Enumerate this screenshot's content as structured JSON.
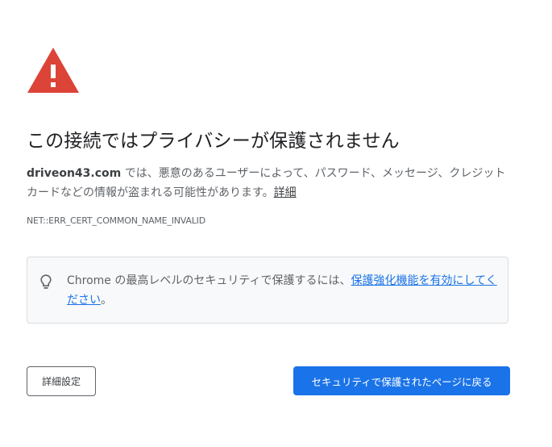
{
  "title": "この接続ではプライバシーが保護されません",
  "message": {
    "domain": "driveon43.com",
    "body": " では、悪意のあるユーザーによって、パスワード、メッセージ、クレジット カードなどの情報が盗まれる可能性があります。",
    "details_link": "詳細"
  },
  "error_code": "NET::ERR_CERT_COMMON_NAME_INVALID",
  "enhanced_protection": {
    "text": "Chrome の最高レベルのセキュリティで保護するには、",
    "link": "保護強化機能を有効にしてください",
    "suffix": "。",
    "icon": "lightbulb-icon"
  },
  "buttons": {
    "advanced": "詳細設定",
    "back_to_safety": "セキュリティで保護されたページに戻る"
  },
  "colors": {
    "warning_red": "#db4437",
    "primary_blue": "#1a73e8",
    "title_text": "#202124",
    "body_text": "#5f6368"
  }
}
